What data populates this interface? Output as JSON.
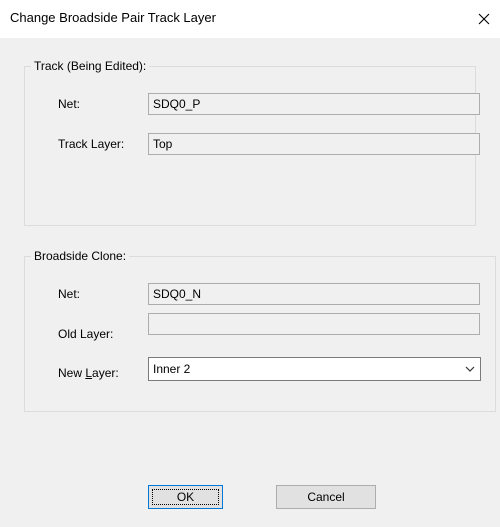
{
  "window": {
    "title": "Change Broadside Pair Track Layer"
  },
  "track_group": {
    "legend": "Track (Being Edited):",
    "net_label": "Net:",
    "net_value": "SDQ0_P",
    "layer_label": "Track Layer:",
    "layer_value": "Top"
  },
  "clone_group": {
    "legend": "Broadside Clone:",
    "net_label": "Net:",
    "net_value": "SDQ0_N",
    "old_layer_label": "Old Layer:",
    "old_layer_value": "",
    "new_layer_label_prefix": "New ",
    "new_layer_label_hotkey": "L",
    "new_layer_label_suffix": "ayer:",
    "new_layer_value": "Inner 2"
  },
  "buttons": {
    "ok_label": "OK",
    "cancel_label": "Cancel"
  },
  "icons": {
    "close": "close-icon",
    "dropdown": "chevron-down-icon"
  }
}
